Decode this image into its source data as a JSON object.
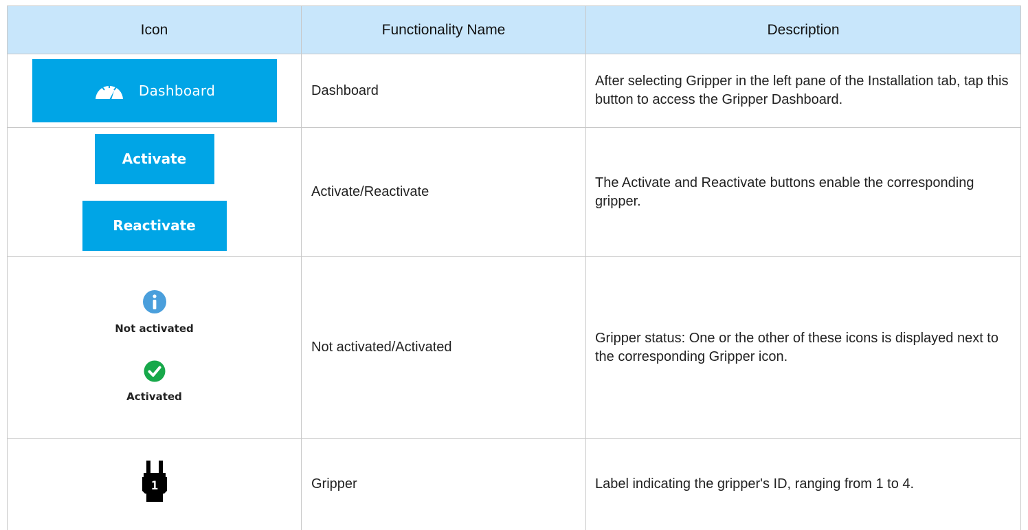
{
  "table": {
    "headers": {
      "icon": "Icon",
      "name": "Functionality Name",
      "description": "Description"
    },
    "rows": [
      {
        "icon": {
          "button_label": "Dashboard",
          "icon": "speedometer-icon"
        },
        "name": "Dashboard",
        "description": "After selecting Gripper in the left pane of the Installation tab, tap this button to access the Gripper Dashboard."
      },
      {
        "icon": {
          "activate_label": "Activate",
          "reactivate_label": "Reactivate"
        },
        "name": "Activate/Reactivate",
        "description": "The Activate and Reactivate buttons enable the corresponding gripper."
      },
      {
        "icon": {
          "not_activated_label": "Not activated",
          "not_activated_icon": "info-icon",
          "activated_label": "Activated",
          "activated_icon": "checkmark-icon"
        },
        "name": "Not activated/Activated",
        "description": "Gripper status: One or the other of these icons is displayed next to the corresponding Gripper icon."
      },
      {
        "icon": {
          "gripper_id": "1",
          "icon": "gripper-icon"
        },
        "name": "Gripper",
        "description": "Label indicating the gripper's ID, ranging from 1 to 4."
      }
    ]
  },
  "colors": {
    "header_bg": "#c8e6fb",
    "button_blue": "#00a5e6",
    "info_blue": "#4a9fdc",
    "success_green": "#17a84a"
  }
}
